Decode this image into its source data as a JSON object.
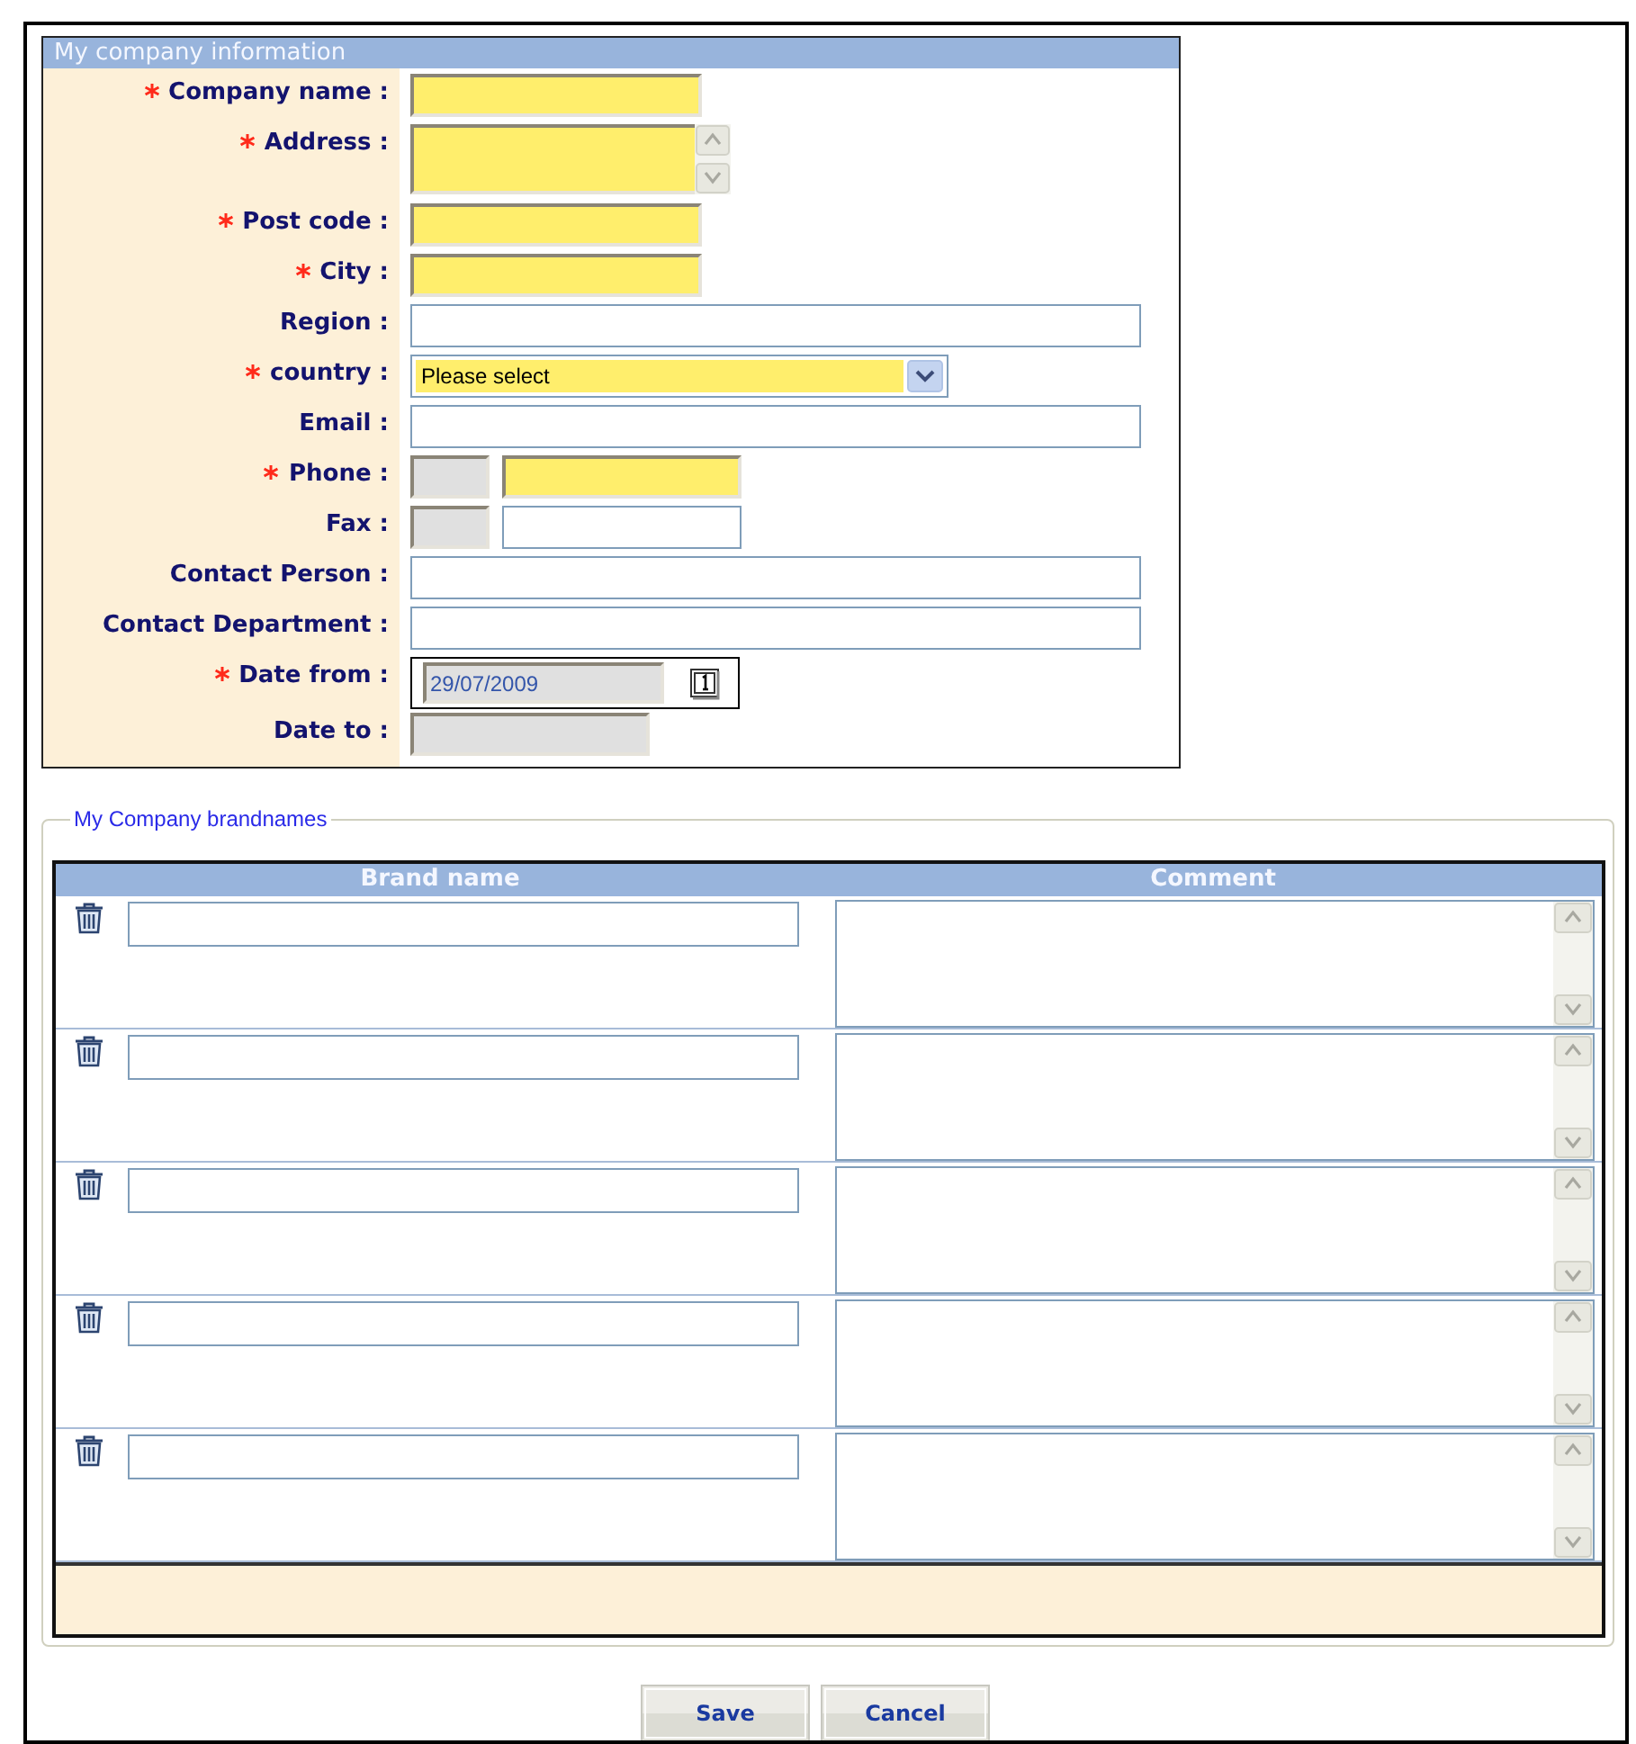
{
  "company_panel": {
    "title": "My company information",
    "fields": [
      {
        "label": "Company name :",
        "kind": "short",
        "required": true
      },
      {
        "label": "Address :",
        "kind": "textarea",
        "required": true
      },
      {
        "label": "Post code :",
        "kind": "short",
        "required": true
      },
      {
        "label": "City :",
        "kind": "short",
        "required": true
      },
      {
        "label": "Region :",
        "kind": "long",
        "required": false
      },
      {
        "label": "country :",
        "kind": "select",
        "required": true,
        "value": "Please select"
      },
      {
        "label": "Email :",
        "kind": "long",
        "required": false
      },
      {
        "label": "Phone :",
        "kind": "phone",
        "required": true
      },
      {
        "label": "Fax :",
        "kind": "phone",
        "required": false
      },
      {
        "label": "Contact Person :",
        "kind": "long",
        "required": false
      },
      {
        "label": "Contact Department :",
        "kind": "long",
        "required": false
      },
      {
        "label": "Date from :",
        "kind": "date",
        "required": true,
        "value": "29/07/2009"
      },
      {
        "label": "Date to :",
        "kind": "readonly",
        "required": false
      }
    ]
  },
  "brandnames": {
    "legend": "My Company brandnames",
    "columns": [
      "Brand name",
      "Comment"
    ],
    "rows": [
      {
        "kind": "brand-entry"
      },
      {
        "kind": "brand-entry"
      },
      {
        "kind": "brand-entry"
      },
      {
        "kind": "brand-entry"
      },
      {
        "kind": "brand-entry"
      }
    ]
  },
  "buttons": [
    "Save",
    "Cancel"
  ]
}
